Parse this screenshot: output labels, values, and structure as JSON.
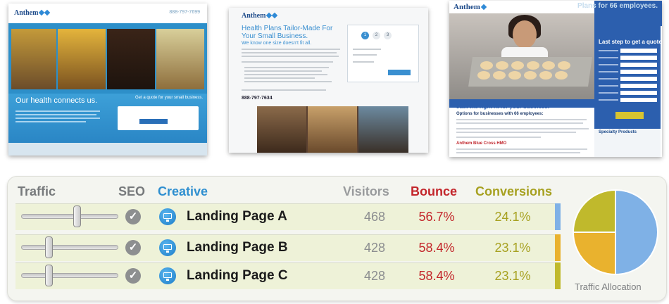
{
  "thumbnails": {
    "page_a": {
      "logo": "Anthem",
      "phone": "888-797-7699",
      "tagline": "Our health connects us.",
      "quote_title": "Get a quote for your small business."
    },
    "page_b": {
      "logo": "Anthem",
      "headline": "Health Plans Tailor-Made For Your Small Business.",
      "subhead": "We know one size doesn't fit all.",
      "phone": "888-797-7634",
      "steps": [
        "1",
        "2",
        "3"
      ]
    },
    "page_c": {
      "logo": "Anthem",
      "banner": "Plans for 66 employees.",
      "form_title": "Last step to get a quote",
      "headline": "Just the right fit for your business.",
      "subhead": "Options for businesses with 66 employees:",
      "red_heading": "Anthem Blue Cross HMO",
      "sidebar_heading": "Specialty Products"
    }
  },
  "headers": {
    "traffic": "Traffic",
    "seo": "SEO",
    "creative": "Creative",
    "visitors": "Visitors",
    "bounce": "Bounce",
    "conversions": "Conversions"
  },
  "rows": [
    {
      "name": "Landing Page A",
      "visitors": "468",
      "bounce": "56.7%",
      "conversions": "24.1%",
      "traffic_level": 0.58,
      "color": "#7fb1e6"
    },
    {
      "name": "Landing Page B",
      "visitors": "428",
      "bounce": "58.4%",
      "conversions": "23.1%",
      "traffic_level": 0.27,
      "color": "#e9b22e"
    },
    {
      "name": "Landing Page C",
      "visitors": "428",
      "bounce": "58.4%",
      "conversions": "23.1%",
      "traffic_level": 0.27,
      "color": "#c0b92c"
    }
  ],
  "icons": {
    "seo": "check-icon",
    "creative": "monitor-icon"
  },
  "traffic_allocation": {
    "label": "Traffic Allocation",
    "slices": [
      {
        "name": "Landing Page A",
        "share": 0.5,
        "color": "#7fb1e6"
      },
      {
        "name": "Landing Page B",
        "share": 0.25,
        "color": "#e9b22e"
      },
      {
        "name": "Landing Page C",
        "share": 0.25,
        "color": "#c0b92c"
      }
    ]
  }
}
